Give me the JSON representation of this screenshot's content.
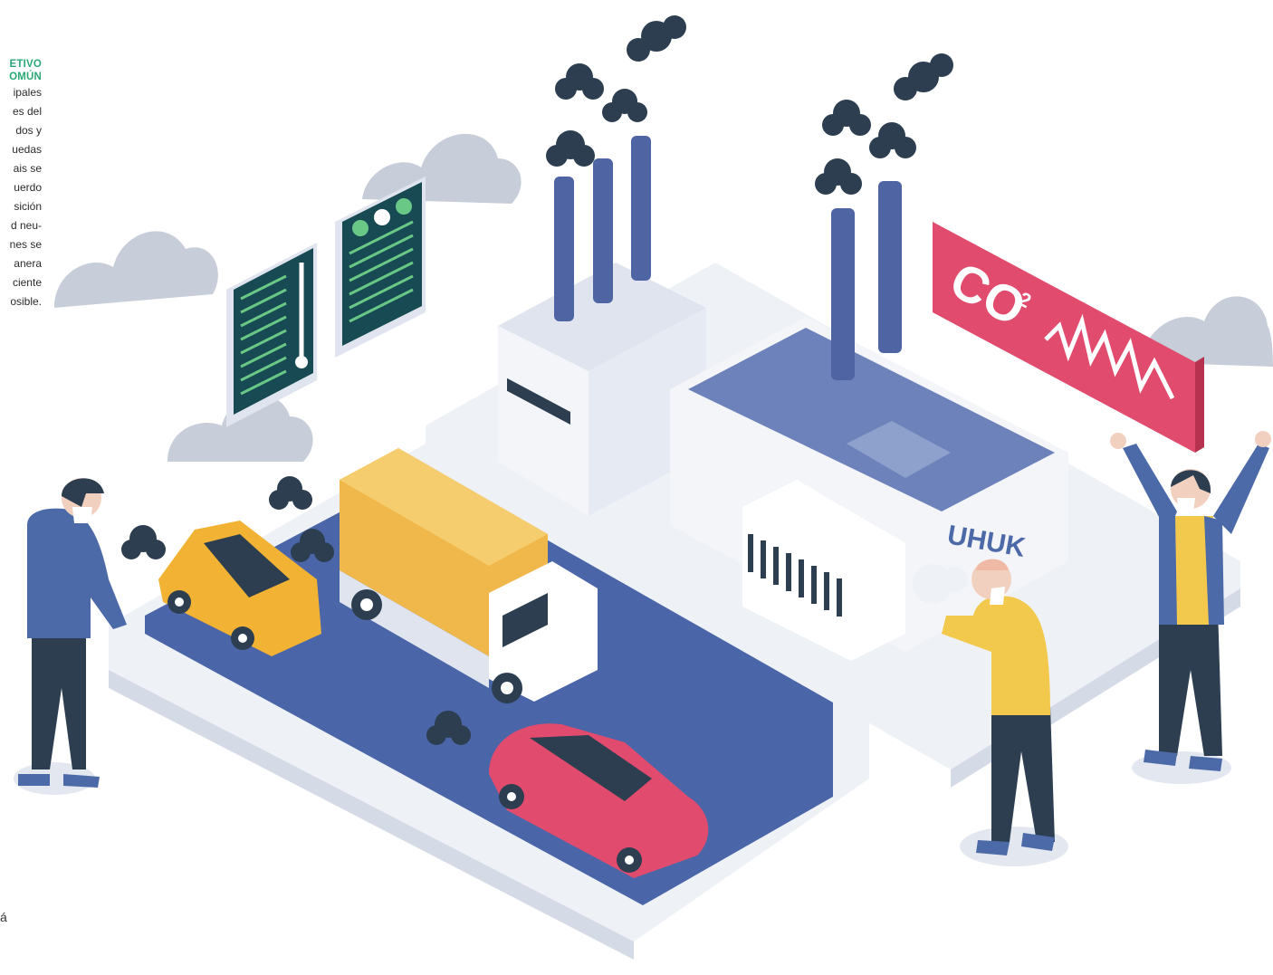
{
  "sidebar": {
    "heading_line1": "ETIVO",
    "heading_line2": "OMÚN",
    "lines": [
      "ipales",
      "es del",
      "dos y",
      "uedas",
      "ais se",
      "uerdo",
      "sición",
      "d neu-",
      "nes se",
      "anera",
      "ciente",
      "osible."
    ],
    "footer": "á"
  },
  "scene": {
    "co2_label": "CO",
    "co2_superscript": "2",
    "cough_label": "UHUK"
  },
  "colors": {
    "navy": "#2c3e50",
    "road": "#4a66a8",
    "chimney": "#4f64a3",
    "co2_sign": "#e14b6e",
    "truck_cargo": "#f0b84a",
    "yellow_car": "#f2b233",
    "pink_car": "#e14b6e",
    "panel": "#174a52",
    "panel_text": "#6ac886",
    "cloud": "#c8ced9",
    "shirt_yellow": "#f2c94c",
    "jacket_blue": "#4d6aa8"
  }
}
